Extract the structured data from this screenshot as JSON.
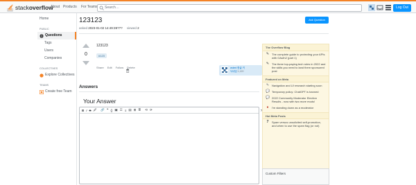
{
  "topbar": {
    "logo_a": "stack",
    "logo_b": "overflow",
    "nav": [
      "About",
      "Products",
      "For Teams"
    ],
    "search_placeholder": "Search…",
    "logout_label": "Log Out"
  },
  "leftnav": {
    "home": "Home",
    "public_label": "PUBLIC",
    "questions": "Questions",
    "tags": "Tags",
    "users": "Users",
    "companies": "Companies",
    "collectives_label": "COLLECTIVES",
    "explore_collectives": "Explore Collectives",
    "teams_label": "TEAMS",
    "create_team": "Create free Team"
  },
  "question": {
    "title": "123123",
    "ask_button": "Ask Question",
    "asked_label": "asked",
    "asked_value": "2023-01-02 14:49:39???",
    "viewed_label": "viewed",
    "viewed_value": "2",
    "vote_count": "0",
    "body": "123123",
    "tag": "#123",
    "actions": [
      "Share",
      "Edit",
      "Follow",
      "Delete"
    ],
    "user_asked": "asked 한글 키",
    "user_name": "닉네임",
    "user_rep": "1,120"
  },
  "answers": {
    "heading": "Answers",
    "your_answer": "Your Answer",
    "toolbar_icons": [
      "B",
      "I",
      "S",
      "🖉",
      "🔗",
      "❝",
      "{}",
      "▣",
      "☰",
      "≡",
      "▤",
      "⊞",
      "≣",
      "⟲",
      "⟳",
      "?",
      "▥",
      "▦",
      "◧"
    ]
  },
  "sidebar": {
    "blog_heading": "The Overflow Blog",
    "blog_items": [
      {
        "icon": "pencil-icon",
        "text": "The complete guide to protecting your APIs with OAuth2 (part 1)"
      },
      {
        "icon": "pencil-icon",
        "text": "The three top-paying tech roles in 2022 and the skills you need to land them sponsored post"
      }
    ],
    "meta_heading": "Featured on Meta",
    "meta_items": [
      {
        "icon": "chat-icon",
        "text": "Navigation and UI research starting soon"
      },
      {
        "icon": "chat-icon",
        "text": "Temporary policy: ChatGPT is banned"
      },
      {
        "icon": "chat-icon",
        "text": "2022 Community Moderator Election Results - now with two more mods!"
      },
      {
        "icon": "stack-icon",
        "text": "I'm standing down as a moderator"
      }
    ],
    "hot_heading": "Hot Meta Posts",
    "hot_items": [
      {
        "num": "7",
        "text": "Spam versus unsolicited self-promotion, and when to use the spam flag (or not)"
      }
    ],
    "custom_filters": "Custom Filters"
  },
  "colors": {
    "accent_orange": "#f48225",
    "button_blue": "#0a95ff",
    "blog_bg": "#fdf7e2"
  }
}
